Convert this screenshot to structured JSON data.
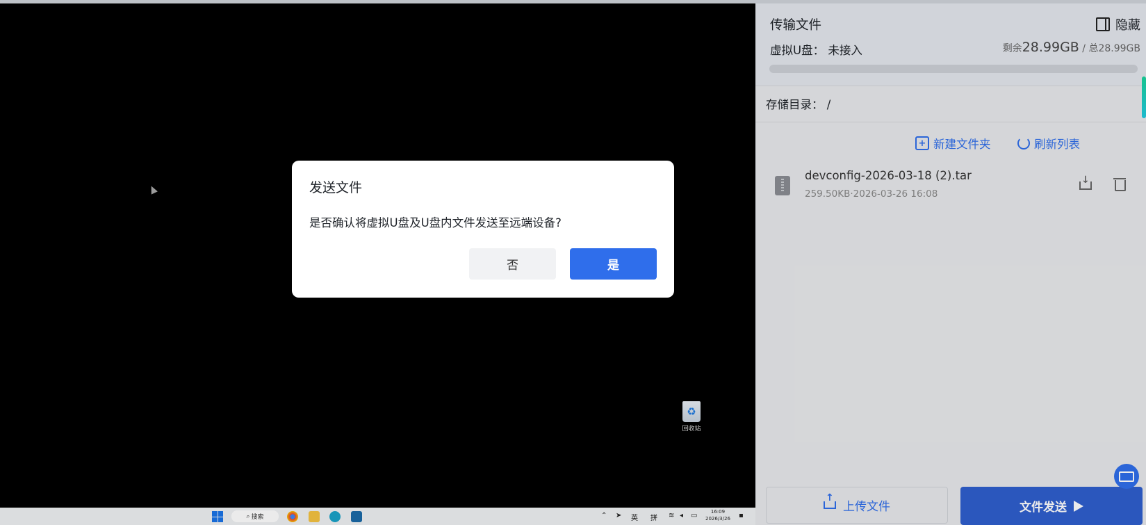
{
  "remote": {
    "recycle_bin_label": "回收站",
    "taskbar": {
      "search_label": "搜索",
      "tray_lang1": "英",
      "tray_lang2": "拼",
      "clock_time": "16:09",
      "clock_date": "2026/3/26"
    }
  },
  "dialog": {
    "title": "发送文件",
    "message": "是否确认将虚拟U盘及U盘内文件发送至远端设备?",
    "cancel_label": "否",
    "confirm_label": "是"
  },
  "panel": {
    "title": "传输文件",
    "hide_label": "隐藏",
    "udisk_label": "虚拟U盘：",
    "udisk_status": "未接入",
    "remaining_prefix": "剩余",
    "remaining_value": "28.99GB",
    "total_text": " / 总28.99GB",
    "usage_fraction": 0.0,
    "directory_label": "存储目录：",
    "directory_path": "/",
    "new_folder_label": "新建文件夹",
    "refresh_label": "刷新列表",
    "files": [
      {
        "name": "devconfig-2026-03-18 (2).tar",
        "size": "259.50KB",
        "date": "2026-03-26 16:08"
      }
    ],
    "upload_label": "上传文件",
    "send_label": "文件发送"
  },
  "colors": {
    "accent": "#2f6eeb",
    "send_button": "#2f5fce"
  }
}
